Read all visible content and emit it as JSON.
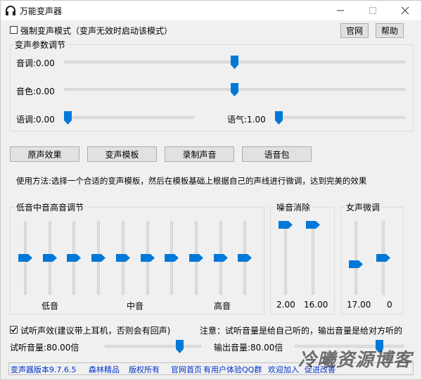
{
  "window": {
    "title": "万能变声器"
  },
  "top": {
    "force_checkbox_label": "强制变声模式（变声无效时启动该模式）",
    "force_checked": false,
    "official_button": "官网",
    "help_button": "帮助"
  },
  "params": {
    "group_title": "变声参数调节",
    "pitch_label": "音调:0.00",
    "timbre_label": "音色:0.00",
    "tone_label": "语调:0.00",
    "breath_label": "语气:1.00",
    "pitch_level": 0.5,
    "timbre_level": 0.5,
    "tone_level": 0.0,
    "breath_level": 0.0
  },
  "actions": {
    "original": "原声效果",
    "templates": "变声模板",
    "record": "录制声音",
    "voice_pack": "语音包"
  },
  "usage_text": "使用方法:选择一个合适的变声模板，然后在模板基础上根据自己的声线进行微调，达到完美的效果",
  "eq": {
    "title": "低音中音高音调节",
    "low": "低音",
    "mid": "中音",
    "high": "高音",
    "levels": [
      0.5,
      0.5,
      0.5,
      0.5,
      0.5,
      0.5,
      0.5,
      0.5,
      0.5,
      0.5
    ]
  },
  "noise": {
    "title": "噪音消除",
    "value1": "2.00",
    "value2": "16.00",
    "levels": [
      1.0,
      1.0
    ]
  },
  "female": {
    "title": "女声微调",
    "value1": "17.00",
    "value2": "0",
    "levels": [
      0.4,
      0.5
    ]
  },
  "monitor": {
    "checkbox_label": "试听声效(建议带上耳机，否则会有回声)",
    "checked": true,
    "note": "注意：试听音量是给自己听的，输出音量是给对方听的",
    "listen_volume_label": "试听音量:80.00倍",
    "output_volume_label": "输出音量:80.00倍",
    "listen_level": 0.8,
    "output_level": 0.8
  },
  "footer": {
    "version": "变声器版本9.7.6.5",
    "brand": "森林精品",
    "rights": "版权所有",
    "homepage": "官网首页",
    "qq_group": "有用户体验QQ群",
    "join": "欢迎加入",
    "improve": "促进改善"
  },
  "watermark": "冷曦资源博客",
  "colors": {
    "accent": "#0078d7",
    "link": "#0033cc"
  }
}
